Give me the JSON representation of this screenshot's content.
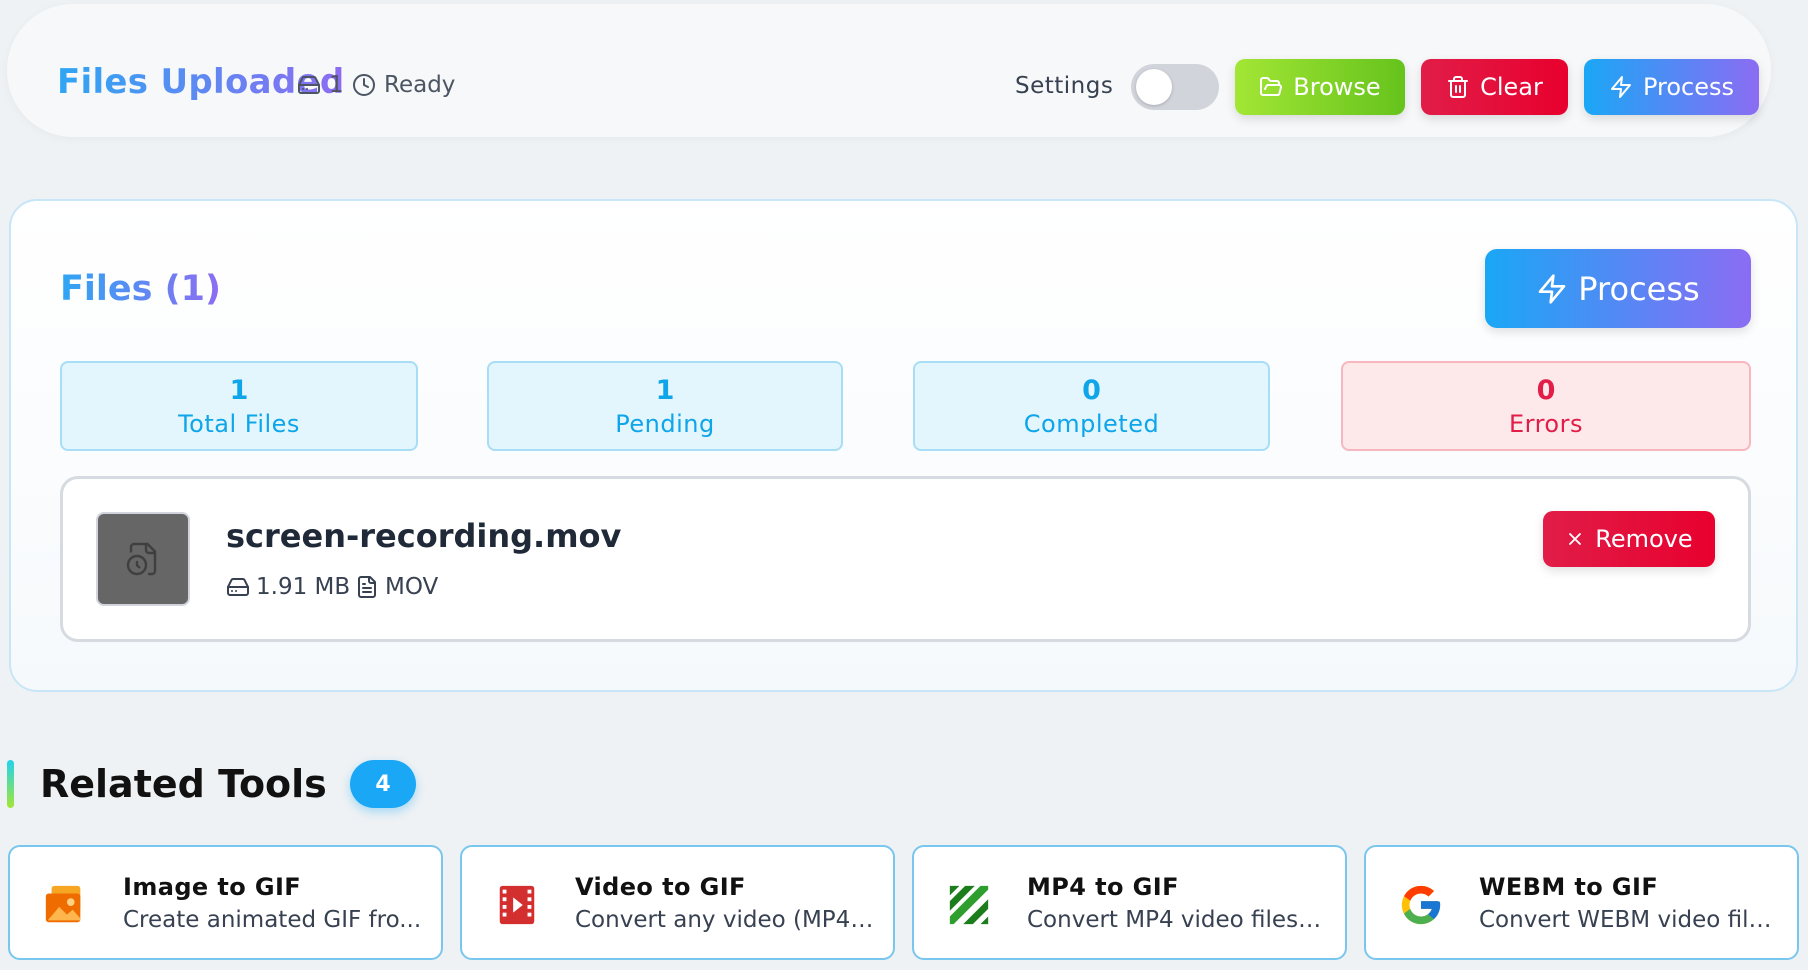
{
  "header": {
    "title": "Files Uploaded",
    "file_count": "1",
    "status": "Ready",
    "settings_label": "Settings",
    "settings_enabled": false,
    "browse_label": "Browse",
    "clear_label": "Clear",
    "process_label": "Process"
  },
  "files_panel": {
    "title": "Files (1)",
    "process_label": "Process",
    "stats": [
      {
        "value": "1",
        "label": "Total Files"
      },
      {
        "value": "1",
        "label": "Pending"
      },
      {
        "value": "0",
        "label": "Completed"
      },
      {
        "value": "0",
        "label": "Errors"
      }
    ],
    "file": {
      "name": "screen-recording.mov",
      "size": "1.91 MB",
      "type": "MOV",
      "remove_label": "Remove"
    }
  },
  "related": {
    "title": "Related Tools",
    "count": "4",
    "tools": [
      {
        "name": "Image to GIF",
        "description": "Create animated GIF fro...",
        "icon": "image-icon"
      },
      {
        "name": "Video to GIF",
        "description": "Convert any video (MP4,...",
        "icon": "film-icon"
      },
      {
        "name": "MP4 to GIF",
        "description": "Convert MP4 video files t...",
        "icon": "ffmpeg-icon"
      },
      {
        "name": "WEBM to GIF",
        "description": "Convert WEBM video files...",
        "icon": "google-icon"
      }
    ]
  },
  "colors": {
    "accent_blue": "#1aa7f5",
    "accent_purple": "#8b6cf3",
    "danger": "#e11d48",
    "success": "#65c31c"
  }
}
